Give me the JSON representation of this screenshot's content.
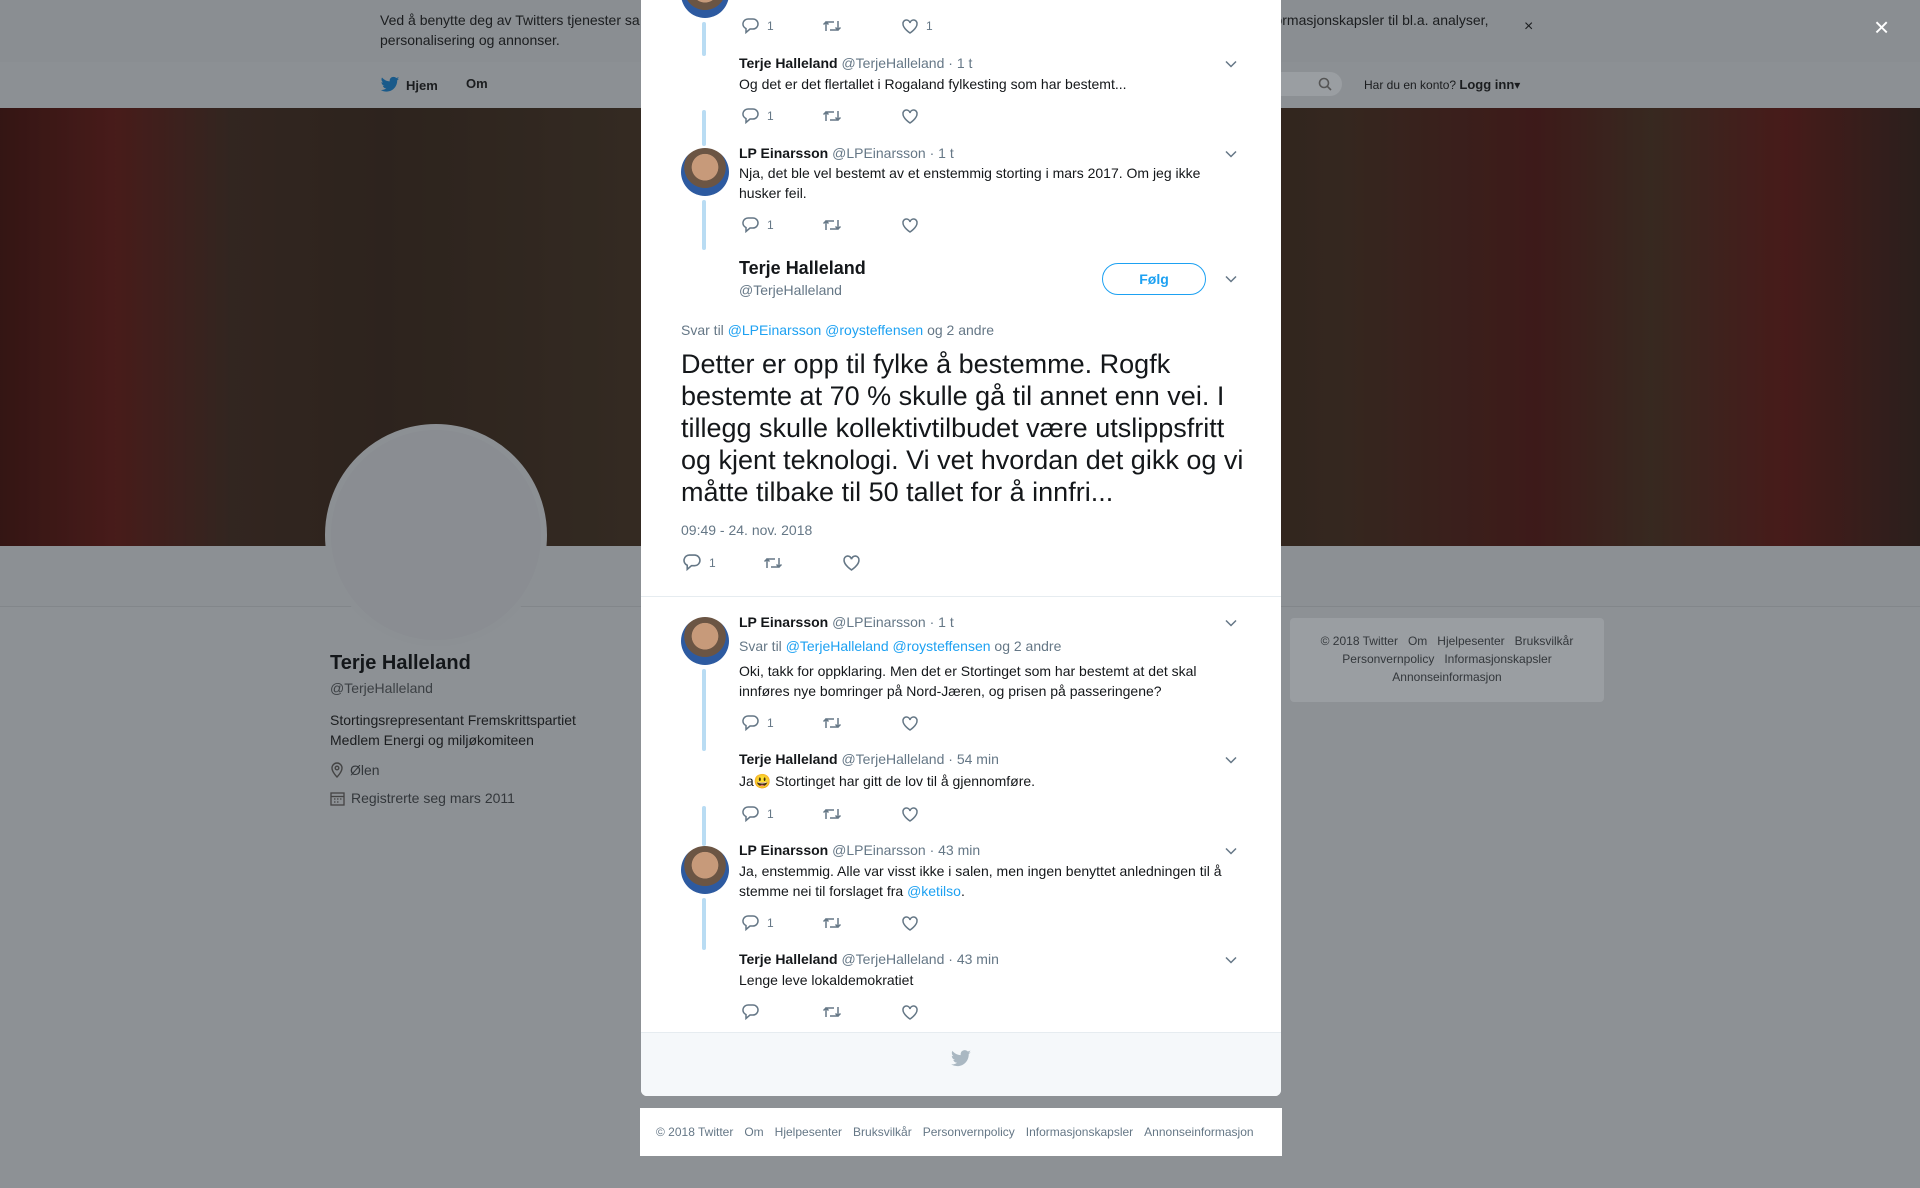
{
  "cookie": {
    "text": "Ved å benytte deg av Twitters tjenester sa... informasjonskapsler til bl.a. analyser, personalisering og annonser.",
    "text_left": "Ved å benytte deg av Twitters tjenester sa",
    "text_right": "informasjonskapsler til bl.a. analyser,",
    "text_line2": "personalisering og annonser.",
    "close": "×"
  },
  "nav": {
    "home": "Hjem",
    "about": "Om",
    "account_question": "Har du en konto?",
    "login": "Logg inn"
  },
  "profile": {
    "name": "Terje Halleland",
    "handle": "@TerjeHalleland",
    "bio_line1": "Stortingsrepresentant Fremskrittspartiet",
    "bio_line2": "Medlem Energi og miljøkomiteen",
    "location": "Ølen",
    "registered": "Registrerte seg mars 2011"
  },
  "right_footer": {
    "copyright": "© 2018 Twitter",
    "about": "Om",
    "help": "Hjelpesenter",
    "terms": "Bruksvilkår",
    "privacy": "Personvernpolicy",
    "cookies": "Informasjonskapsler",
    "ads": "Annonseinformasjon"
  },
  "modal_close": "×",
  "thread_top": [
    {
      "reply_count": "1",
      "like_count": "1"
    }
  ],
  "tweets_before": [
    {
      "name": "Terje Halleland",
      "handle": "@TerjeHalleland",
      "time": "· 1 t",
      "text": "Og det er det flertallet i Rogaland fylkesting som har bestemt...",
      "reply_count": "1"
    },
    {
      "name": "LP Einarsson",
      "handle": "@LPEinarsson",
      "time": "· 1 t",
      "text": "Nja, det ble vel bestemt av et enstemmig storting i mars 2017. Om jeg ikke husker feil.",
      "reply_count": "1"
    }
  ],
  "main_tweet": {
    "name": "Terje Halleland",
    "handle": "@TerjeHalleland",
    "follow": "Følg",
    "reply_prefix": "Svar til",
    "reply_to1": "@LPEinarsson",
    "reply_to2": "@roysteffensen",
    "reply_suffix": "og 2 andre",
    "text": "Detter er opp til fylke å bestemme. Rogfk bestemte at 70 % skulle gå til annet enn vei. I tillegg skulle kollektivtilbudet være utslippsfritt og kjent teknologi. Vi vet hvordan det gikk og vi måtte tilbake til 50 tallet for å innfri...",
    "timestamp": "09:49 - 24. nov. 2018",
    "reply_count": "1"
  },
  "replies": [
    {
      "name": "LP Einarsson",
      "handle": "@LPEinarsson",
      "time": "· 1 t",
      "reply_prefix": "Svar til",
      "reply_to1": "@TerjeHalleland",
      "reply_to2": "@roysteffensen",
      "reply_suffix": "og 2 andre",
      "text": "Oki, takk for oppklaring. Men det er Stortinget som har bestemt at det skal innføres nye bomringer på Nord-Jæren, og prisen på passeringene?",
      "reply_count": "1"
    },
    {
      "name": "Terje Halleland",
      "handle": "@TerjeHalleland",
      "time": "· 54 min",
      "text_prefix": "Ja",
      "emoji": "😃",
      "text_rest": " Stortinget har gitt de lov til å gjennomføre.",
      "reply_count": "1"
    },
    {
      "name": "LP Einarsson",
      "handle": "@LPEinarsson",
      "time": "· 43 min",
      "text": "Ja, enstemmig. Alle var visst ikke i salen, men ingen benyttet anledningen til å stemme nei til forslaget fra ",
      "mention": "@ketilso",
      "text_end": ".",
      "reply_count": "1"
    },
    {
      "name": "Terje Halleland",
      "handle": "@TerjeHalleland",
      "time": "· 43 min",
      "text": "Lenge leve lokaldemokratiet"
    }
  ],
  "modal_footer": {
    "copyright": "© 2018 Twitter",
    "about": "Om",
    "help": "Hjelpesenter",
    "terms": "Bruksvilkår",
    "privacy": "Personvernpolicy",
    "cookies": "Informasjonskapsler",
    "ads": "Annonseinformasjon"
  },
  "colors": {
    "accent": "#1da1f2",
    "thread_line": "#b9dcf3",
    "muted_text": "#657786",
    "overlay": "#8d9195"
  },
  "icons": [
    "twitter-bird-icon",
    "search-icon",
    "close-icon",
    "location-icon",
    "calendar-icon",
    "reply-icon",
    "retweet-icon",
    "like-icon",
    "chevron-down-icon"
  ]
}
